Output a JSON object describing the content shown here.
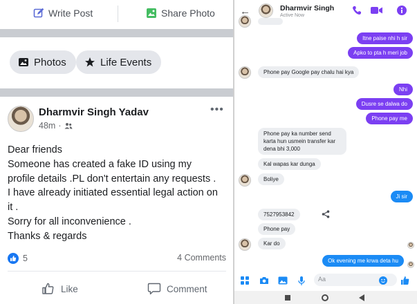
{
  "left": {
    "composer": {
      "write_post": "Write Post",
      "share_photo": "Share Photo"
    },
    "chips": {
      "photos": "Photos",
      "life_events": "Life Events"
    },
    "post": {
      "author": "Dharmvir Singh Yadav",
      "time": "48m",
      "audience_icon": "friends-icon",
      "lines": [
        "Dear friends",
        "Someone has created a fake ID using my",
        "profile details .PL don't  entertain any requests .",
        "I have already initiated essential legal action on",
        "it .",
        "Sorry for all inconvenience .",
        "Thanks & regards"
      ],
      "reaction_count": "5",
      "comment_count": "4 Comments",
      "like_label": "Like",
      "comment_label": "Comment"
    }
  },
  "right": {
    "header": {
      "name": "Dharmvir Singh",
      "status": "Active Now"
    },
    "messages": {
      "m1": "Itne paise nhi h sir",
      "m2": "Apko to pta h meri job",
      "m3": "Phone pay Google pay chalu hai kya",
      "m4": "Nhi",
      "m5": "Dusre se dalwa do",
      "m6": "Phone pay me",
      "m7": "Phone pay  ka number send karta hun usmein transfer kar dena bhi 3,000",
      "m8": "Kal wapas kar dunga",
      "m9": "Boliye",
      "m10": "Ji sir",
      "m11": "7527953842",
      "m12": "Phone pay",
      "m13": "Kar do",
      "m14": "Ok evening me krwa deta hu"
    },
    "composer": {
      "placeholder": "Aa"
    }
  },
  "colors": {
    "messenger_purple": "#7b3ff2",
    "messenger_blue": "#1b8bf5",
    "facebook_blue": "#1877f2",
    "photo_green": "#45bd62"
  }
}
